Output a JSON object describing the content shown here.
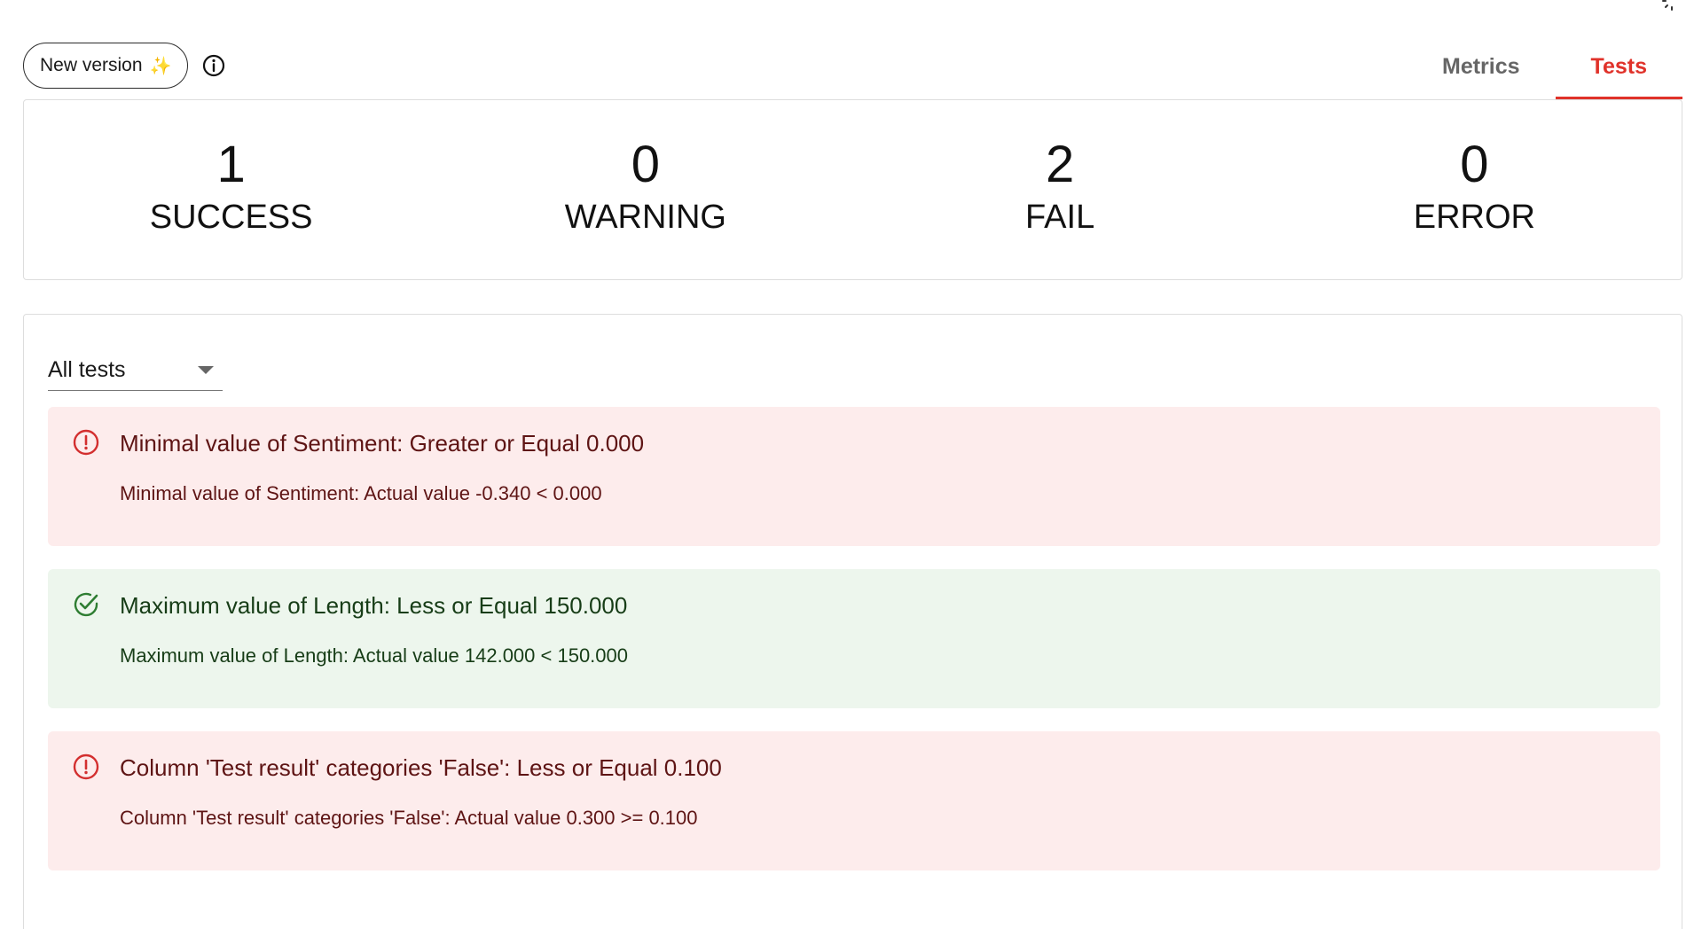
{
  "toolbar": {
    "new_version_label": "New version",
    "sparkle": "✨",
    "icons": {
      "info": "info-circle-icon",
      "spinner": "loading-spinner-icon"
    }
  },
  "tabs": [
    {
      "label": "Metrics",
      "active": false
    },
    {
      "label": "Tests",
      "active": true
    }
  ],
  "summary": {
    "success": {
      "value": "1",
      "label": "SUCCESS"
    },
    "warning": {
      "value": "0",
      "label": "WARNING"
    },
    "fail": {
      "value": "2",
      "label": "FAIL"
    },
    "error": {
      "value": "0",
      "label": "ERROR"
    }
  },
  "filter": {
    "selected": "All tests"
  },
  "tests": [
    {
      "status": "fail",
      "icon": "alert-circle-icon",
      "title": "Minimal value of Sentiment: Greater or Equal 0.000",
      "description": "Minimal value of Sentiment: Actual value -0.340 < 0.000"
    },
    {
      "status": "success",
      "icon": "check-circle-icon",
      "title": "Maximum value of Length: Less or Equal 150.000",
      "description": "Maximum value of Length: Actual value 142.000 < 150.000"
    },
    {
      "status": "fail",
      "icon": "alert-circle-icon",
      "title": "Column 'Test result' categories 'False': Less or Equal 0.100",
      "description": "Column 'Test result' categories 'False': Actual value 0.300 >= 0.100"
    }
  ],
  "colors": {
    "accent": "#e0322a",
    "fail_bg": "#fdecec",
    "fail_icon": "#d32f2f",
    "success_bg": "#edf6ed",
    "success_icon": "#2e7d32"
  }
}
